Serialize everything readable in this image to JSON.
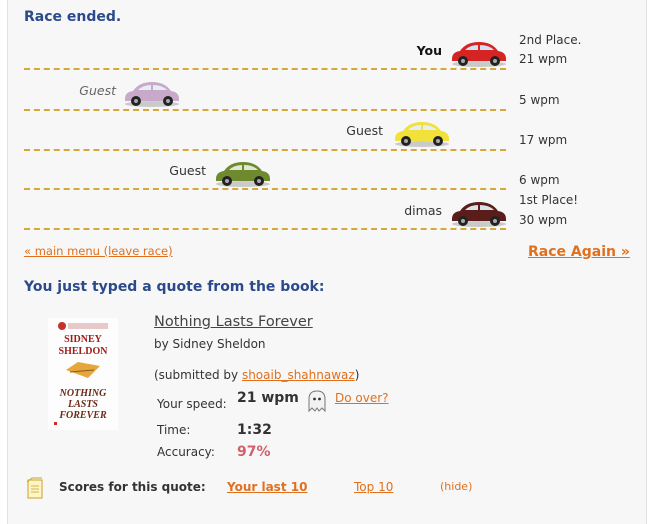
{
  "race": {
    "status": "Race ended.",
    "racers": [
      {
        "name": "You",
        "result_line1": "2nd Place.",
        "result_line2": "21 wpm",
        "car_color": "#d62424",
        "progress": 1.0
      },
      {
        "name": "Guest",
        "result_line1": "",
        "result_line2": "5 wpm",
        "car_color": "#c9a9c9",
        "progress": 0.24
      },
      {
        "name": "Guest",
        "result_line1": "",
        "result_line2": "17 wpm",
        "car_color": "#f0e23a",
        "progress": 0.8
      },
      {
        "name": "Guest",
        "result_line1": "",
        "result_line2": "6 wpm",
        "car_color": "#6f8a2e",
        "progress": 0.41
      },
      {
        "name": "dimas",
        "result_line1": "1st Place!",
        "result_line2": "30 wpm",
        "car_color": "#5a1d1a",
        "progress": 1.0
      }
    ],
    "main_menu_link": "« main menu (leave race)",
    "race_again_link": "Race Again »"
  },
  "quote": {
    "heading": "You just typed a quote from the book:",
    "book_title": "Nothing Lasts Forever",
    "author": "by Sidney Sheldon",
    "submitted_prefix": "(submitted by ",
    "submitted_by": "shoaib_shahnawaz",
    "submitted_suffix": ")",
    "cover": {
      "author_text": "SIDNEY SHELDON",
      "title_text": "NOTHING LASTS FOREVER"
    },
    "speed_label": "Your speed:",
    "speed_value": "21 wpm",
    "do_over": "Do over?",
    "time_label": "Time:",
    "time_value": "1:32",
    "accuracy_label": "Accuracy:",
    "accuracy_value": "97%"
  },
  "scores": {
    "label": "Scores for this quote:",
    "your_last_10": "Your last 10",
    "top_10": "Top 10",
    "hide": "(hide)"
  },
  "colors": {
    "accent": "#e0701e",
    "heading": "#2b4a8b",
    "lane": "#d6a73b",
    "accuracy": "#d0606b"
  }
}
